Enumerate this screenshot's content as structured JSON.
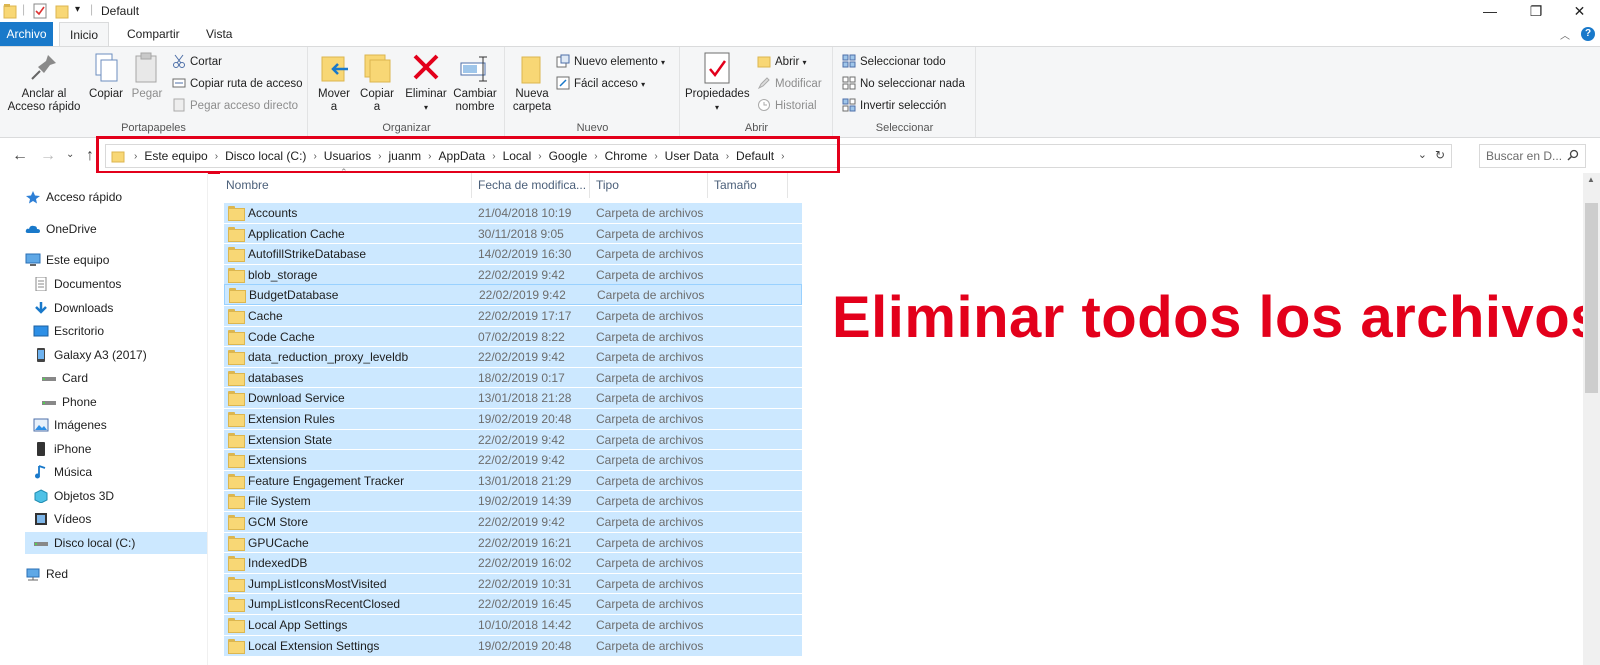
{
  "window": {
    "title": "Default",
    "minimize": "—",
    "restore": "❐",
    "close": "✕",
    "help": "?"
  },
  "tabs": [
    {
      "label": "Archivo"
    },
    {
      "label": "Inicio"
    },
    {
      "label": "Compartir"
    },
    {
      "label": "Vista"
    }
  ],
  "ribbon": {
    "portapapeles": {
      "label": "Portapapeles",
      "pin": "Anclar al\nAcceso rápido",
      "copy": "Copiar",
      "paste": "Pegar",
      "cut": "Cortar",
      "copy_path": "Copiar ruta de acceso",
      "paste_shortcut": "Pegar acceso directo"
    },
    "organizar": {
      "label": "Organizar",
      "move": "Mover\na",
      "copy_to": "Copiar\na",
      "delete": "Eliminar",
      "rename": "Cambiar\nnombre"
    },
    "nuevo": {
      "label": "Nuevo",
      "new_folder": "Nueva\ncarpeta",
      "new_item": "Nuevo elemento",
      "easy_access": "Fácil acceso"
    },
    "abrir": {
      "label": "Abrir",
      "properties": "Propiedades",
      "open": "Abrir",
      "edit": "Modificar",
      "history": "Historial"
    },
    "seleccionar": {
      "label": "Seleccionar",
      "select_all": "Seleccionar todo",
      "select_none": "No seleccionar nada",
      "invert": "Invertir selección"
    }
  },
  "address": {
    "crumbs": [
      "Este equipo",
      "Disco local (C:)",
      "Usuarios",
      "juanm",
      "AppData",
      "Local",
      "Google",
      "Chrome",
      "User Data",
      "Default"
    ],
    "search_placeholder": "Buscar en D..."
  },
  "sidebar": {
    "items": [
      {
        "label": "Acceso rápido",
        "icon": "star-icon"
      },
      {
        "label": "OneDrive",
        "icon": "cloud-icon"
      },
      {
        "label": "Este equipo",
        "icon": "computer-icon"
      },
      {
        "label": "Documentos",
        "icon": "document-icon"
      },
      {
        "label": "Downloads",
        "icon": "download-icon"
      },
      {
        "label": "Escritorio",
        "icon": "desktop-icon"
      },
      {
        "label": "Galaxy A3 (2017)",
        "icon": "phone-icon"
      },
      {
        "label": "Card",
        "icon": "drive-icon"
      },
      {
        "label": "Phone",
        "icon": "drive-icon"
      },
      {
        "label": "Imágenes",
        "icon": "image-icon"
      },
      {
        "label": "iPhone",
        "icon": "phone-icon"
      },
      {
        "label": "Música",
        "icon": "music-icon"
      },
      {
        "label": "Objetos 3D",
        "icon": "cube-icon"
      },
      {
        "label": "Vídeos",
        "icon": "video-icon"
      },
      {
        "label": "Disco local (C:)",
        "icon": "drive-icon"
      },
      {
        "label": "Red",
        "icon": "network-icon"
      }
    ]
  },
  "columns": {
    "name": "Nombre",
    "date": "Fecha de modifica...",
    "type": "Tipo",
    "size": "Tamaño"
  },
  "files": [
    {
      "name": "Accounts",
      "date": "21/04/2018 10:19",
      "type": "Carpeta de archivos"
    },
    {
      "name": "Application Cache",
      "date": "30/11/2018 9:05",
      "type": "Carpeta de archivos"
    },
    {
      "name": "AutofillStrikeDatabase",
      "date": "14/02/2019 16:30",
      "type": "Carpeta de archivos"
    },
    {
      "name": "blob_storage",
      "date": "22/02/2019 9:42",
      "type": "Carpeta de archivos"
    },
    {
      "name": "BudgetDatabase",
      "date": "22/02/2019 9:42",
      "type": "Carpeta de archivos"
    },
    {
      "name": "Cache",
      "date": "22/02/2019 17:17",
      "type": "Carpeta de archivos"
    },
    {
      "name": "Code Cache",
      "date": "07/02/2019 8:22",
      "type": "Carpeta de archivos"
    },
    {
      "name": "data_reduction_proxy_leveldb",
      "date": "22/02/2019 9:42",
      "type": "Carpeta de archivos"
    },
    {
      "name": "databases",
      "date": "18/02/2019 0:17",
      "type": "Carpeta de archivos"
    },
    {
      "name": "Download Service",
      "date": "13/01/2018 21:28",
      "type": "Carpeta de archivos"
    },
    {
      "name": "Extension Rules",
      "date": "19/02/2019 20:48",
      "type": "Carpeta de archivos"
    },
    {
      "name": "Extension State",
      "date": "22/02/2019 9:42",
      "type": "Carpeta de archivos"
    },
    {
      "name": "Extensions",
      "date": "22/02/2019 9:42",
      "type": "Carpeta de archivos"
    },
    {
      "name": "Feature Engagement Tracker",
      "date": "13/01/2018 21:29",
      "type": "Carpeta de archivos"
    },
    {
      "name": "File System",
      "date": "19/02/2019 14:39",
      "type": "Carpeta de archivos"
    },
    {
      "name": "GCM Store",
      "date": "22/02/2019 9:42",
      "type": "Carpeta de archivos"
    },
    {
      "name": "GPUCache",
      "date": "22/02/2019 16:21",
      "type": "Carpeta de archivos"
    },
    {
      "name": "IndexedDB",
      "date": "22/02/2019 16:02",
      "type": "Carpeta de archivos"
    },
    {
      "name": "JumpListIconsMostVisited",
      "date": "22/02/2019 10:31",
      "type": "Carpeta de archivos"
    },
    {
      "name": "JumpListIconsRecentClosed",
      "date": "22/02/2019 16:45",
      "type": "Carpeta de archivos"
    },
    {
      "name": "Local App Settings",
      "date": "10/10/2018 14:42",
      "type": "Carpeta de archivos"
    },
    {
      "name": "Local Extension Settings",
      "date": "19/02/2019 20:48",
      "type": "Carpeta de archivos"
    }
  ],
  "overlay_text": "Eliminar todos los archivos",
  "colors": {
    "accent": "#1979ca",
    "selection": "#cce8ff",
    "annotation_red": "#e3001b"
  }
}
